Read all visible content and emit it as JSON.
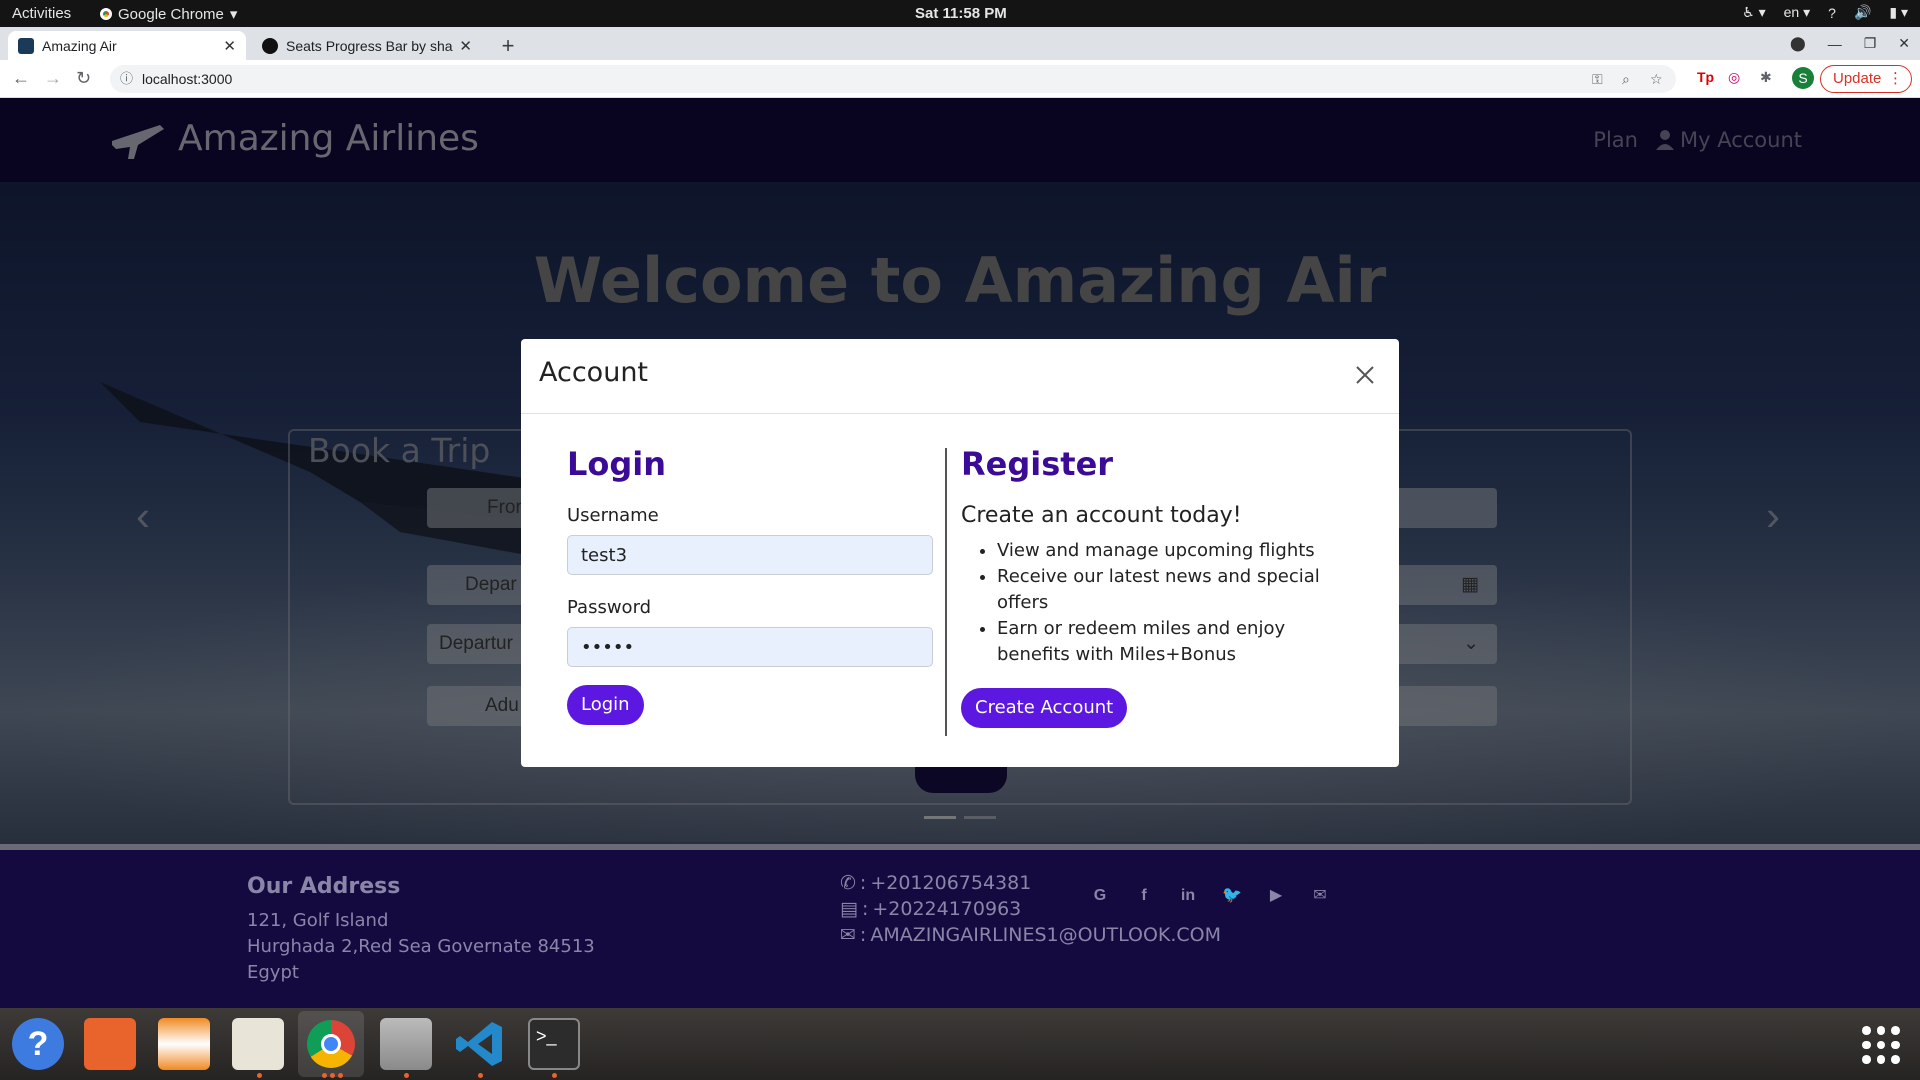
{
  "system": {
    "activities": "Activities",
    "app_menu": "Google Chrome",
    "clock": "Sat 11:58 PM",
    "lang": "en"
  },
  "browser": {
    "tabs": [
      {
        "title": "Amazing Air",
        "active": true
      },
      {
        "title": "Seats Progress Bar by sha",
        "active": false
      }
    ],
    "url": "localhost:3000",
    "update_label": "Update",
    "profile_initial": "S"
  },
  "site": {
    "brand": "Amazing Airlines",
    "nav": {
      "plan": "Plan",
      "account": "My Account"
    },
    "hero_title": "Welcome to Amazing Air",
    "booking": {
      "title": "Book a Trip",
      "fields": [
        "Fror",
        "Depar",
        "Departur",
        "Adu"
      ]
    },
    "footer": {
      "address_heading": "Our Address",
      "address_lines": [
        "121, Golf Island",
        "Hurghada 2,Red Sea Governate 84513",
        "Egypt"
      ],
      "phone": "+201206754381",
      "fax": "+20224170963",
      "email": "AMAZINGAIRLINES1@OUTLOOK.COM"
    }
  },
  "modal": {
    "title": "Account",
    "login": {
      "heading": "Login",
      "username_label": "Username",
      "username_value": "test3",
      "password_label": "Password",
      "password_value": "•••••",
      "button": "Login"
    },
    "register": {
      "heading": "Register",
      "subheading": "Create an account today!",
      "bullets": [
        "View and manage upcoming flights",
        "Receive our latest news and special offers",
        "Earn or redeem miles and enjoy benefits with Miles+Bonus"
      ],
      "button": "Create Account"
    }
  },
  "colors": {
    "accent": "#5c17e0",
    "heading": "#3b0a96",
    "navbar": "#120840",
    "footer": "#150a40"
  }
}
